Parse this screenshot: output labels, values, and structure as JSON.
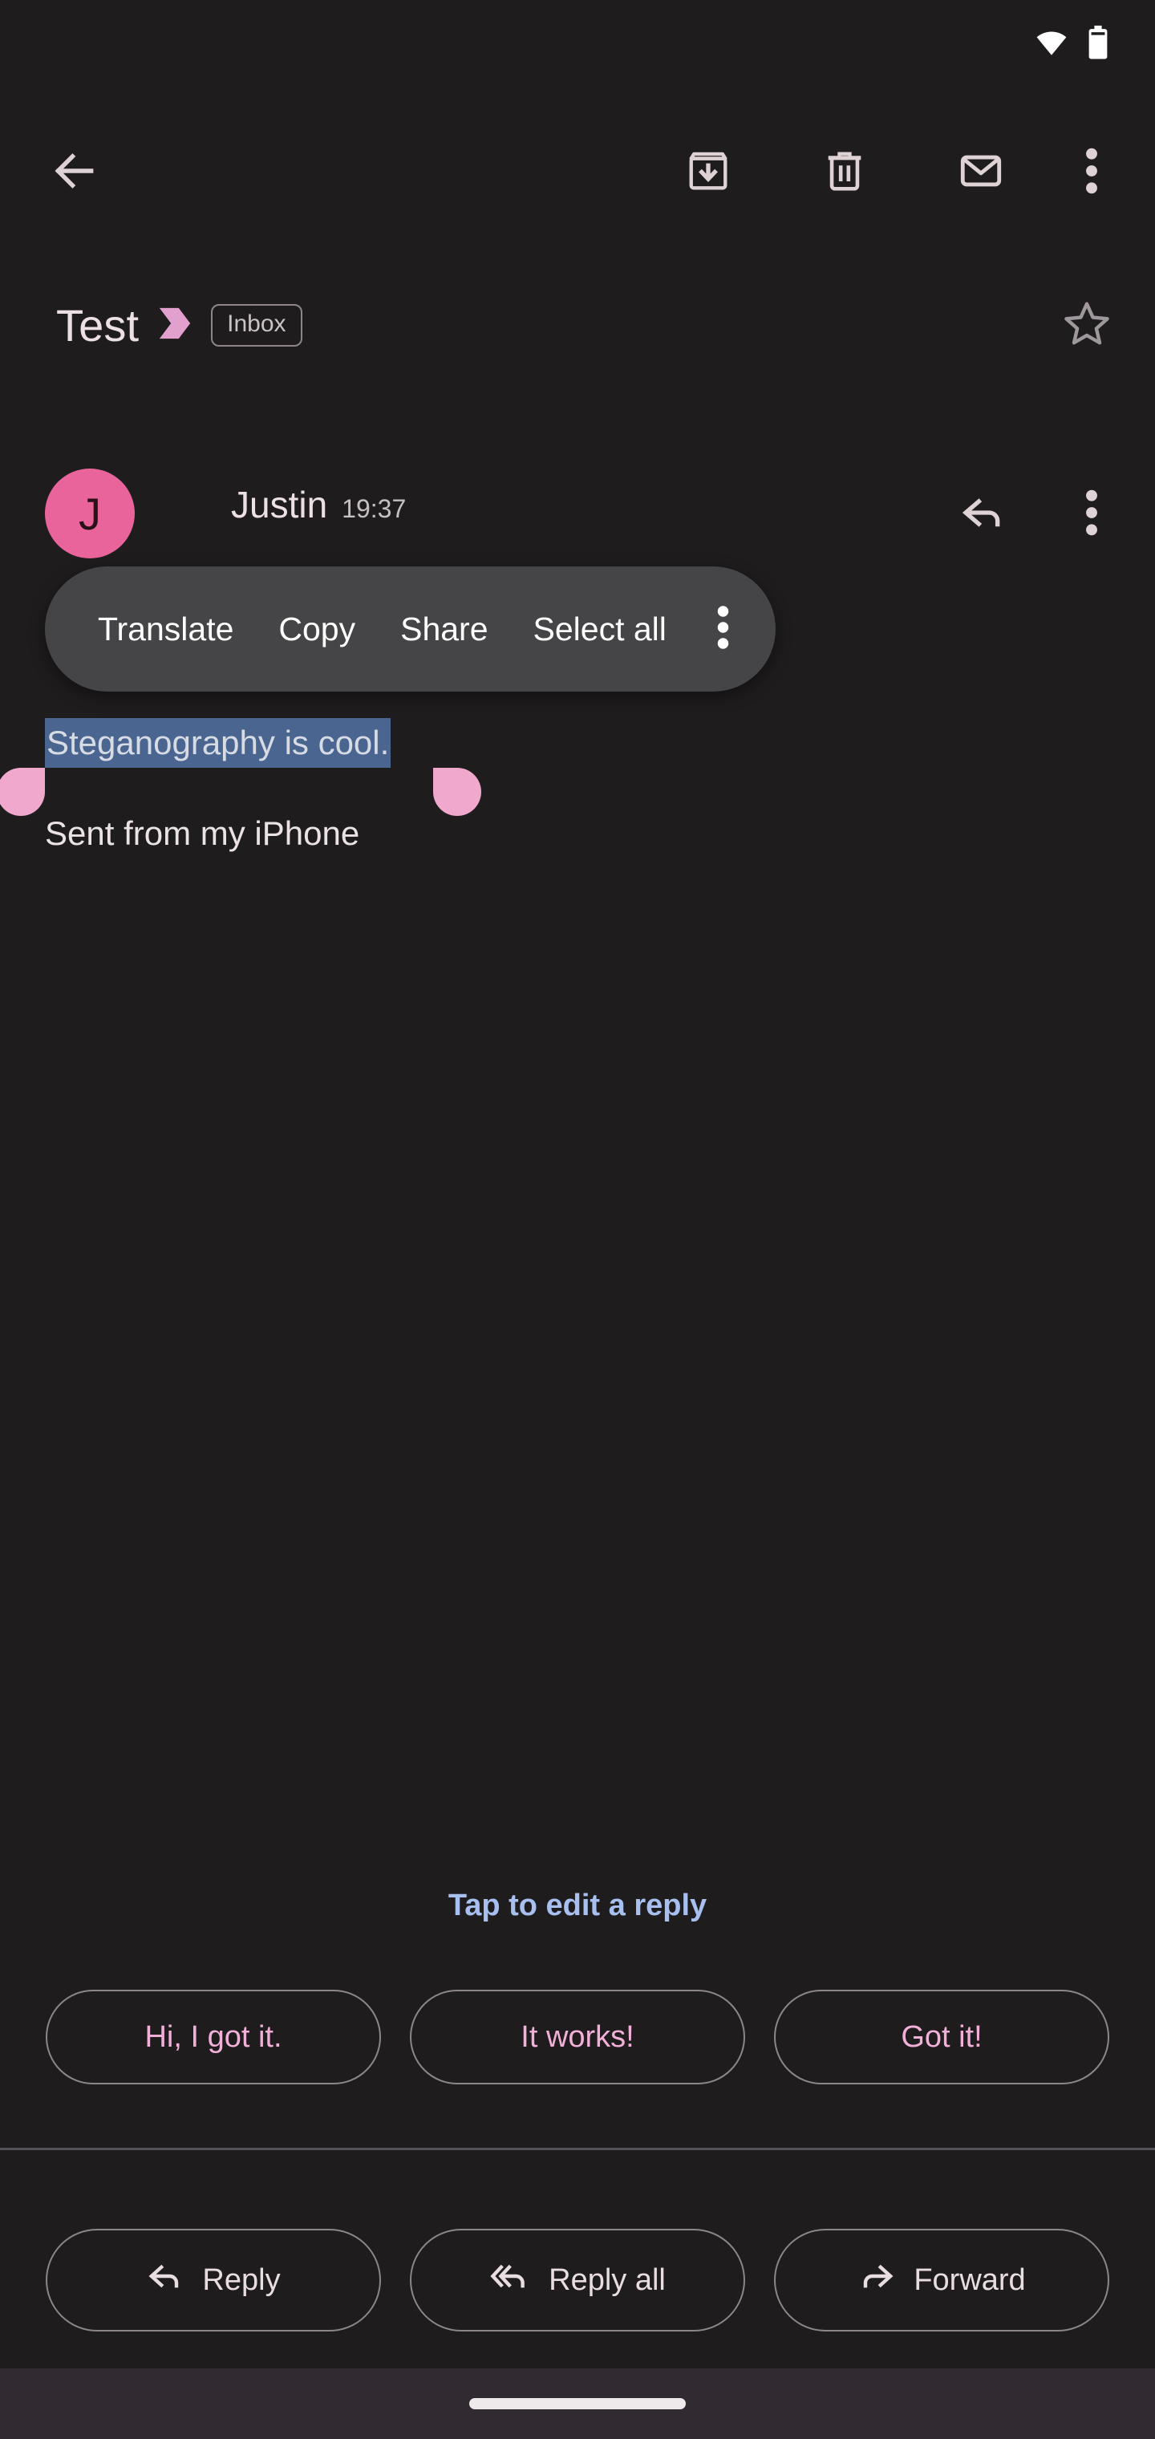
{
  "status_bar": {
    "wifi_icon": "wifi-icon",
    "battery_icon": "battery-icon"
  },
  "app_bar": {
    "back_icon": "back-arrow-icon",
    "archive_icon": "archive-icon",
    "delete_icon": "trash-icon",
    "unread_icon": "mark-unread-envelope-icon",
    "overflow_icon": "more-vert-icon"
  },
  "subject": {
    "title": "Test",
    "important_marker_icon": "important-chevron-icon",
    "label": "Inbox",
    "star_icon": "star-outline-icon"
  },
  "message": {
    "avatar_letter": "J",
    "avatar_color": "#e8649a",
    "sender": "Justin",
    "time": "19:37",
    "reply_icon": "reply-arrow-icon",
    "overflow_icon": "more-vert-icon",
    "selected_text": "Steganography is cool.",
    "signature": "Sent from my iPhone",
    "selection_highlight_color": "#4b6591",
    "selection_handle_color": "#f0a8cd"
  },
  "context_menu": {
    "items": [
      {
        "label": "Translate"
      },
      {
        "label": "Copy"
      },
      {
        "label": "Share"
      },
      {
        "label": "Select all"
      }
    ],
    "overflow_icon": "more-vert-icon",
    "background_color": "#454547"
  },
  "smart_reply": {
    "edit_link": "Tap to edit a reply",
    "edit_link_color": "#a8c0f0",
    "chip_text_color": "#f2b0d8",
    "chips": [
      {
        "label": "Hi, I got it."
      },
      {
        "label": "It works!"
      },
      {
        "label": "Got it!"
      }
    ]
  },
  "action_bar": {
    "actions": [
      {
        "label": "Reply",
        "icon": "reply-arrow-icon"
      },
      {
        "label": "Reply all",
        "icon": "reply-all-arrow-icon"
      },
      {
        "label": "Forward",
        "icon": "forward-arrow-icon"
      }
    ]
  },
  "nav_bar": {
    "gesture_pill_icon": "home-gesture-pill"
  }
}
